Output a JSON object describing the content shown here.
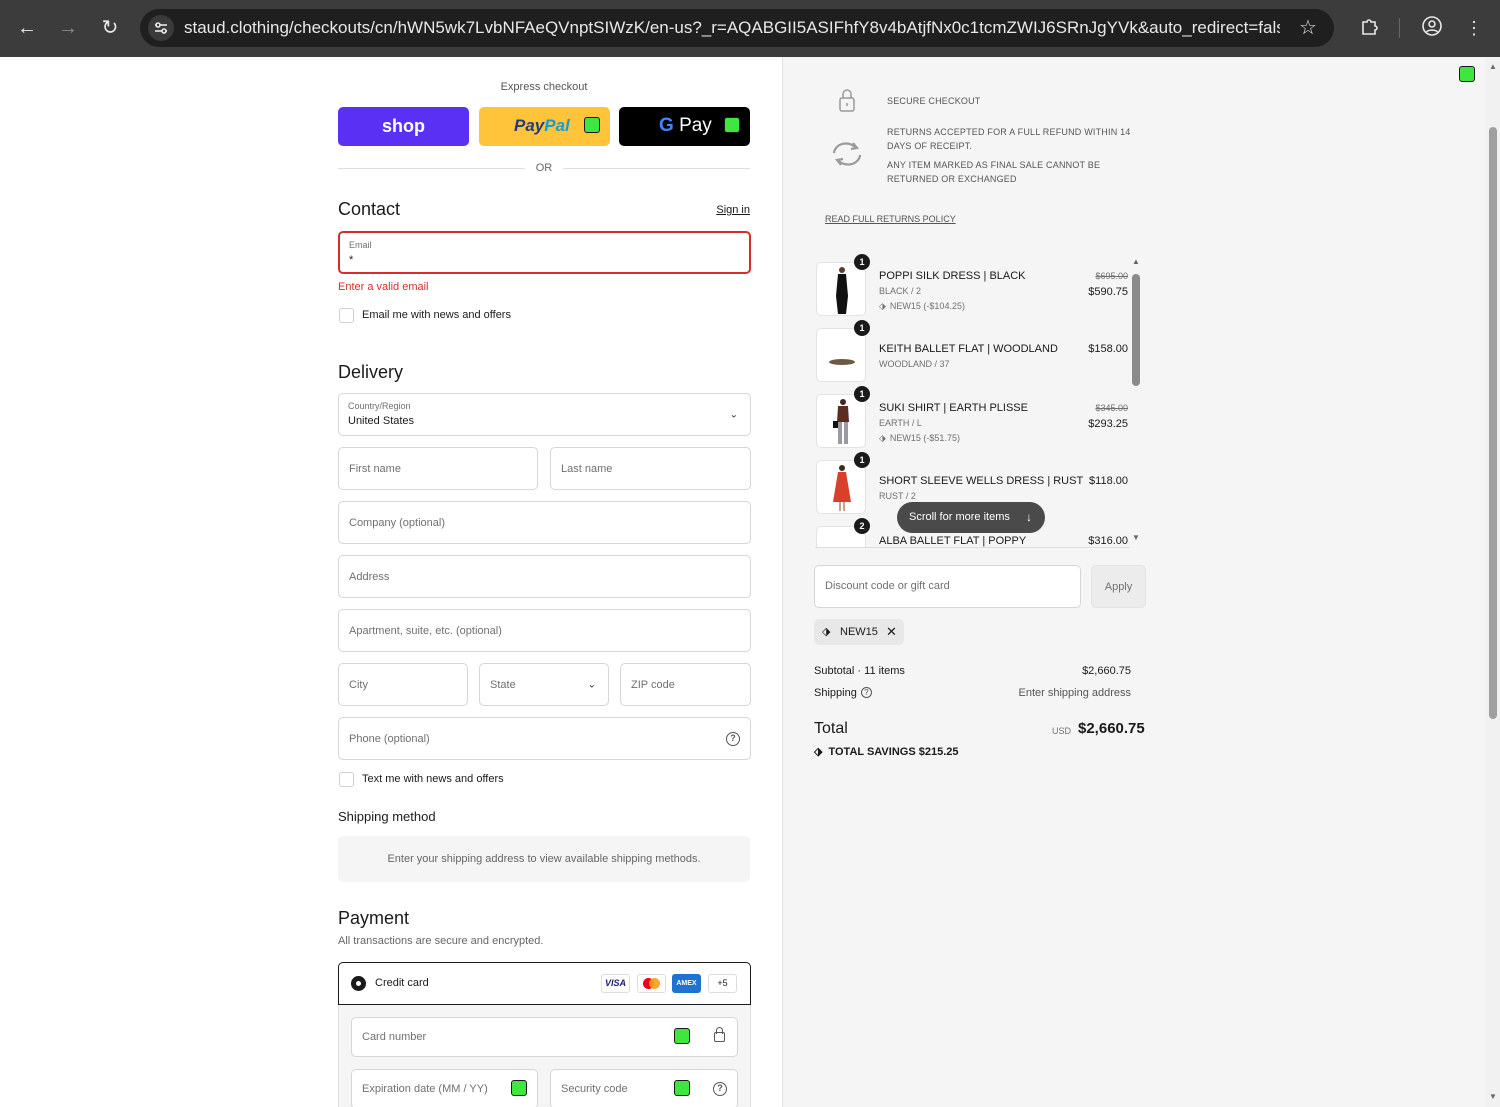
{
  "browser": {
    "url": "staud.clothing/checkouts/cn/hWN5wk7LvbNFAeQVnptSIWzK/en-us?_r=AQABGII5ASIFhfY8v4bAtjfNx0c1tcmZWIJ6SRnJgYVk&auto_redirect=false&edg..."
  },
  "express": {
    "label": "Express checkout",
    "shop_label": "shop",
    "paypal_part1": "Pay",
    "paypal_part2": "Pal",
    "gpay_g": "G",
    "gpay_label": "Pay",
    "or_label": "OR"
  },
  "contact": {
    "heading": "Contact",
    "sign_in": "Sign in",
    "email_label": "Email",
    "email_value": "*",
    "error": "Enter a valid email",
    "newsletter_label": "Email me with news and offers"
  },
  "delivery": {
    "heading": "Delivery",
    "country_label": "Country/Region",
    "country_value": "United States",
    "first_name": "First name",
    "last_name": "Last name",
    "company": "Company (optional)",
    "address": "Address",
    "apartment": "Apartment, suite, etc. (optional)",
    "city": "City",
    "state": "State",
    "zip": "ZIP code",
    "phone": "Phone (optional)",
    "sms_label": "Text me with news and offers"
  },
  "shipping": {
    "heading": "Shipping method",
    "message": "Enter your shipping address to view available shipping methods."
  },
  "payment": {
    "heading": "Payment",
    "subtitle": "All transactions are secure and encrypted.",
    "credit_card_label": "Credit card",
    "cards": [
      "VISA",
      "",
      "AMEX",
      "+5"
    ],
    "card_number": "Card number",
    "expiration": "Expiration date (MM / YY)",
    "security_code": "Security code"
  },
  "policy": {
    "secure_checkout": "SECURE CHECKOUT",
    "returns_line1": "RETURNS ACCEPTED FOR A FULL REFUND WITHIN 14",
    "returns_line2": "DAYS OF RECEIPT.",
    "final_line1": "ANY ITEM MARKED AS FINAL SALE CANNOT BE",
    "final_line2": "RETURNED OR EXCHANGED",
    "link": "READ FULL RETURNS POLICY"
  },
  "cart": {
    "items": [
      {
        "qty": "1",
        "name": "POPPI SILK DRESS | BLACK",
        "variant": "BLACK / 2",
        "discount": "NEW15 (-$104.25)",
        "original_price": "$695.00",
        "price": "$590.75"
      },
      {
        "qty": "1",
        "name": "KEITH BALLET FLAT | WOODLAND",
        "variant": "WOODLAND / 37",
        "discount": "",
        "original_price": "",
        "price": "$158.00"
      },
      {
        "qty": "1",
        "name": "SUKI SHIRT | EARTH PLISSE",
        "variant": "EARTH / L",
        "discount": "NEW15 (-$51.75)",
        "original_price": "$345.00",
        "price": "$293.25"
      },
      {
        "qty": "1",
        "name": "SHORT SLEEVE WELLS DRESS | RUST",
        "variant": "RUST / 2",
        "discount": "",
        "original_price": "",
        "price": "$118.00"
      },
      {
        "qty": "2",
        "name": "ALBA BALLET FLAT | POPPY",
        "variant": "",
        "discount": "",
        "original_price": "",
        "price": "$316.00"
      }
    ],
    "scroll_hint": "Scroll for more items",
    "discount_placeholder": "Discount code or gift card",
    "apply_label": "Apply",
    "applied_code": "NEW15"
  },
  "summary": {
    "subtotal_label": "Subtotal · 11 items",
    "subtotal_value": "$2,660.75",
    "shipping_label": "Shipping",
    "shipping_value": "Enter shipping address",
    "total_label": "Total",
    "currency": "USD",
    "total_value": "$2,660.75",
    "savings_label": "TOTAL SAVINGS",
    "savings_value": "$215.25"
  },
  "colors": {
    "shop_purple": "#5a31f4",
    "paypal_yellow": "#ffc439",
    "error_red": "#d82c2c",
    "marker_green": "#3ee63e"
  }
}
